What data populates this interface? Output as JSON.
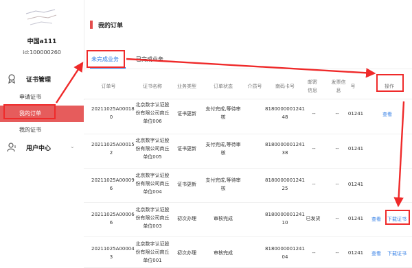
{
  "user": {
    "name": "中国a111",
    "id": "id:100000260"
  },
  "sidebar": {
    "groups": [
      {
        "label": "证书管理",
        "icon": "certificate-icon"
      },
      {
        "label": "用户中心",
        "icon": "user-icon"
      }
    ],
    "items": [
      {
        "label": "申请证书"
      },
      {
        "label": "我的订单"
      },
      {
        "label": "我的证书"
      }
    ]
  },
  "main": {
    "title": "我的订单",
    "tabs": [
      {
        "label": "未完成业务"
      },
      {
        "label": "已完成业务"
      }
    ]
  },
  "table": {
    "headers": [
      "订单号",
      "证书名称",
      "业务类型",
      "订单状态",
      "介质号",
      "南码卡号",
      "邮寄信息",
      "发票信息",
      "号",
      "操作"
    ],
    "rows": [
      {
        "order": [
          "20211025A00018",
          "0"
        ],
        "name": [
          "北京数字认证股",
          "份有限公司商丘",
          "单位006"
        ],
        "type": "证书更新",
        "status": [
          "支付完成,等待审",
          "核"
        ],
        "medium": "",
        "card": [
          "8180000001241",
          "48"
        ],
        "mail": "--",
        "invoice": "--",
        "num": "01241",
        "actions": [
          "查看"
        ]
      },
      {
        "order": [
          "20211025A00015",
          "2"
        ],
        "name": [
          "北京数字认证股",
          "份有限公司商丘",
          "单位005"
        ],
        "type": "证书更新",
        "status": [
          "支付完成,等待审",
          "核"
        ],
        "medium": "",
        "card": [
          "8180000001241",
          "38"
        ],
        "mail": "--",
        "invoice": "--",
        "num": "01241",
        "actions": [
          "查看"
        ]
      },
      {
        "order": [
          "20211025A00009",
          "6"
        ],
        "name": [
          "北京数字认证股",
          "份有限公司商丘",
          "单位004"
        ],
        "type": "证书更新",
        "status": [
          "支付完成,等待审",
          "核"
        ],
        "medium": "",
        "card": [
          "8180000001241",
          "25"
        ],
        "mail": "--",
        "invoice": "--",
        "num": "01241",
        "actions": [
          "查看"
        ]
      },
      {
        "order": [
          "20211025A00006",
          "6"
        ],
        "name": [
          "北京数字认证股",
          "份有限公司商丘",
          "单位003"
        ],
        "type": "初次办理",
        "status": [
          "审核完成"
        ],
        "medium": "",
        "card": [
          "8180000001241",
          "10"
        ],
        "mail": "已发货",
        "invoice": "--",
        "num": "01241",
        "actions": [
          "查看",
          "下载证书"
        ]
      },
      {
        "order": [
          "20211025A00004",
          "3"
        ],
        "name": [
          "北京数字认证股",
          "份有限公司商丘",
          "单位001"
        ],
        "type": "初次办理",
        "status": [
          "审核完成"
        ],
        "medium": "",
        "card": [
          "8180000001241",
          "04"
        ],
        "mail": "--",
        "invoice": "--",
        "num": "01241",
        "actions": [
          "查看",
          "下载证书"
        ]
      }
    ]
  },
  "colors": {
    "accent": "#2d7be5",
    "active_nav": "#e65c5c",
    "annotation": "#ef2a2a"
  }
}
